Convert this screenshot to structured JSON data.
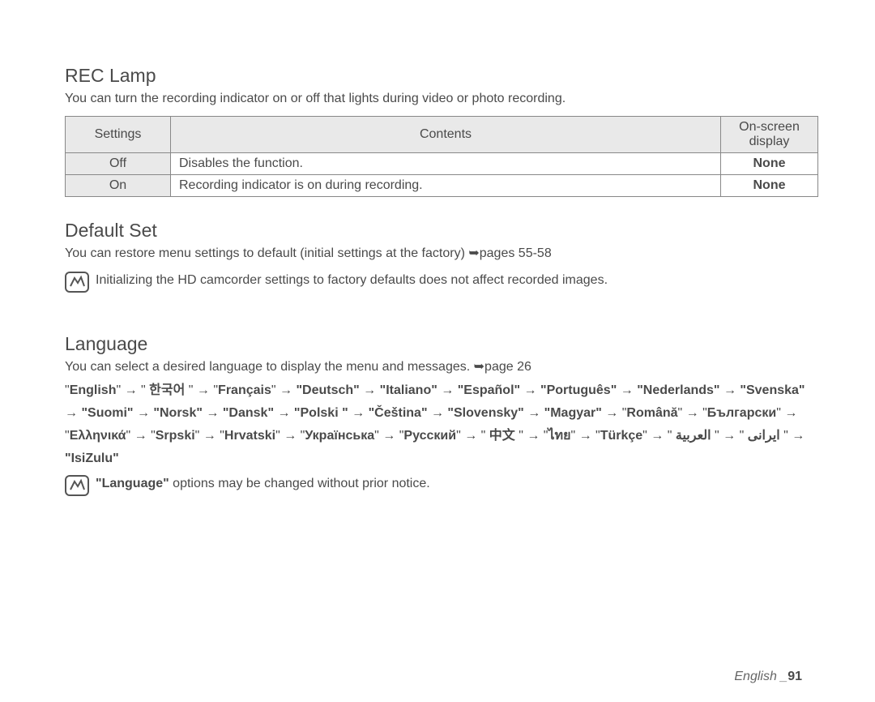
{
  "rec_lamp": {
    "title": "REC Lamp",
    "intro": "You can turn the recording indicator on or off that lights during video or photo recording.",
    "table": {
      "headers": {
        "settings": "Settings",
        "contents": "Contents",
        "display": "On-screen display"
      },
      "rows": [
        {
          "setting": "Off",
          "content": "Disables the function.",
          "display": "None"
        },
        {
          "setting": "On",
          "content": "Recording indicator is on during recording.",
          "display": "None"
        }
      ]
    }
  },
  "default_set": {
    "title": "Default Set",
    "intro_pre": "You can restore menu settings to default (initial settings at the factory) ",
    "intro_ref": "➥pages 55-58",
    "note": "Initializing the HD camcorder settings to factory defaults does not affect recorded images."
  },
  "language": {
    "title": "Language",
    "intro_pre": "You can select a desired language to display the menu and messages. ",
    "intro_ref": "➥page 26",
    "list_html": "\"<b>English</b>\" → \" <b>한국어</b> \" → \"<b>Français</b>\" → <b>\"Deutsch\"</b> → <b>\"Italiano\"</b> → <b>\"Español\"</b> → <b>\"Português\"</b> → <b>\"Nederlands\"</b> → <b>\"Svenska\"</b> → <b>\"Suomi\"</b> → <b>\"Norsk\"</b> → <b>\"Dansk\"</b> → <b>\"Polski \"</b> → <b>\"Čeština\"</b> → <b>\"Slovensky\"</b> → <b>\"Magyar\"</b> → \"<b>Română</b>\" → \"<b>Български</b>\" → \"<b>Ελληνικά</b>\" → \"<b>Srpski</b>\" → \"<b>Hrvatski</b>\" → \"<b>Українська</b>\" → \"<b>Русский</b>\" → \" <b>中文</b> \" → \"<b>ไทย</b>\" → \"<b>Türkçe</b>\" → \" <b>ایرانی</b> \" → \" <b>العربية</b> \" → <b>\"IsiZulu\"</b>",
    "note_bold": "\"Language\"",
    "note_rest": " options may be changed without prior notice."
  },
  "footer": {
    "lang": "English _",
    "page": "91"
  }
}
